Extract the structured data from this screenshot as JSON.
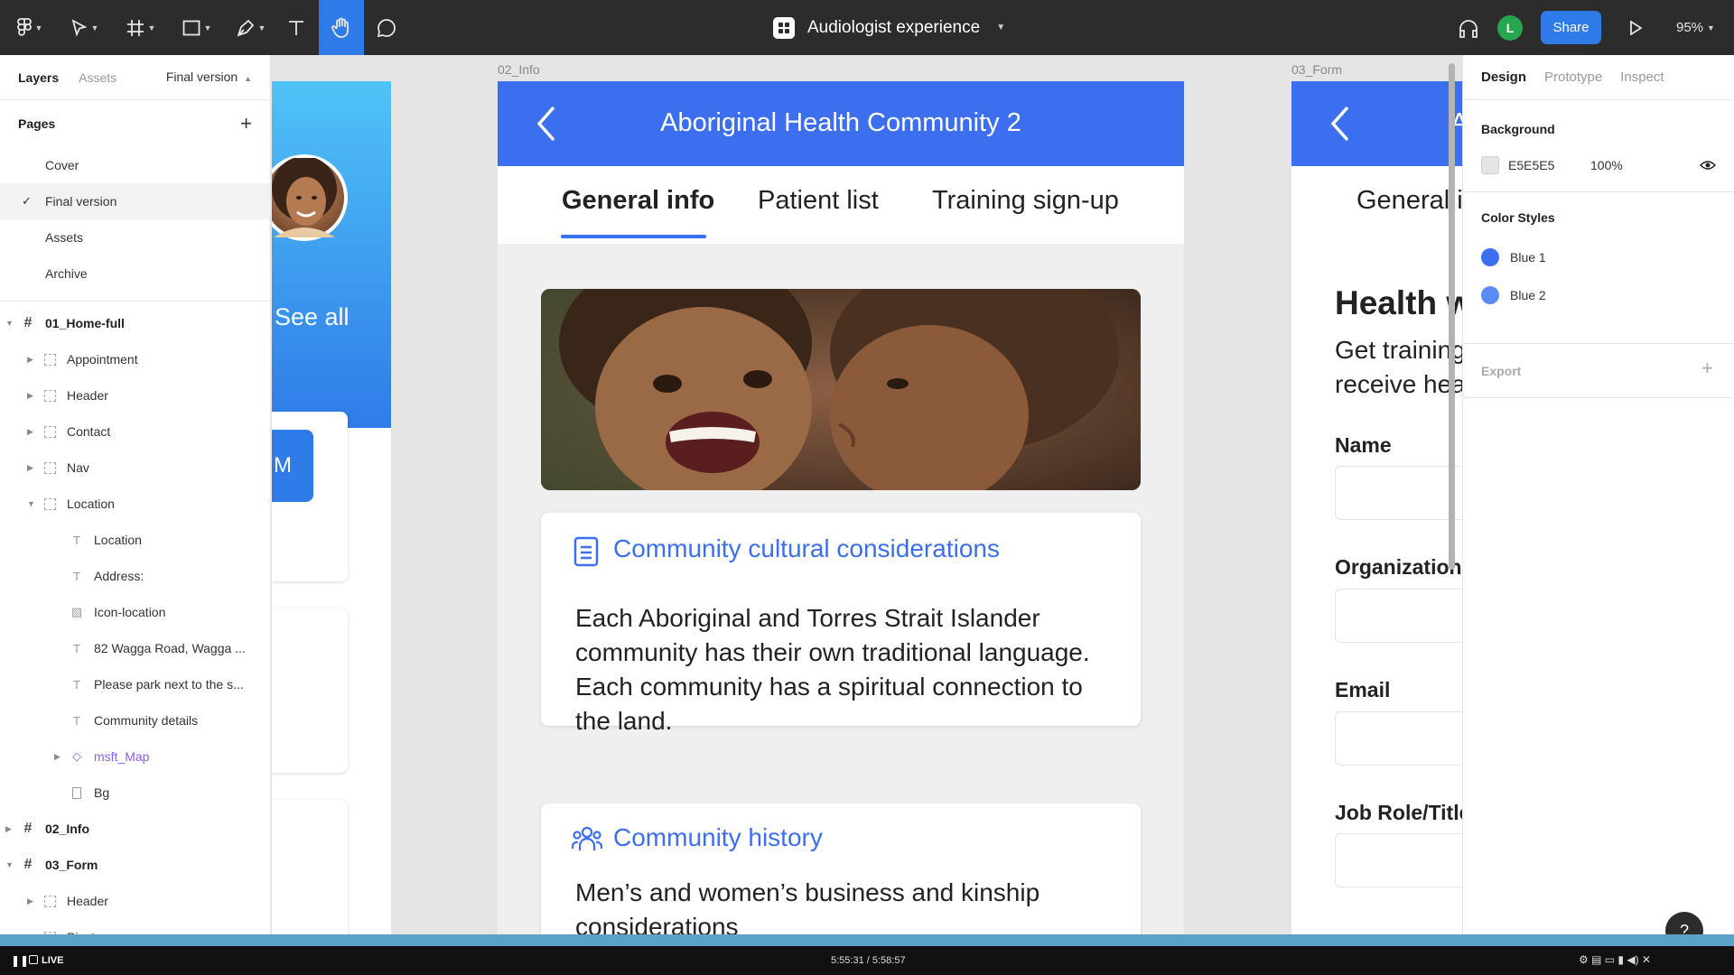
{
  "toolbar": {
    "doc_title": "Audiologist experience",
    "avatar_initial": "L",
    "share_label": "Share",
    "zoom": "95%",
    "accent": "#2f7be8"
  },
  "left_panel": {
    "tabs": [
      "Layers",
      "Assets"
    ],
    "current_page": "Final version",
    "pages_label": "Pages",
    "pages": [
      "Cover",
      "Final version",
      "Assets",
      "Archive"
    ],
    "layers": [
      {
        "label": "01_Home-full",
        "type": "frame",
        "depth": 0,
        "expanded": true
      },
      {
        "label": "Appointment",
        "type": "group",
        "depth": 1
      },
      {
        "label": "Header",
        "type": "group",
        "depth": 1
      },
      {
        "label": "Contact",
        "type": "group",
        "depth": 1
      },
      {
        "label": "Nav",
        "type": "group",
        "depth": 1
      },
      {
        "label": "Location",
        "type": "group",
        "depth": 1,
        "expanded": true
      },
      {
        "label": "Location",
        "type": "text",
        "depth": 2
      },
      {
        "label": "Address:",
        "type": "text",
        "depth": 2
      },
      {
        "label": "Icon-location",
        "type": "image",
        "depth": 2
      },
      {
        "label": "82 Wagga Road, Wagga ...",
        "type": "text",
        "depth": 2
      },
      {
        "label": "Please park next to the s...",
        "type": "text",
        "depth": 2
      },
      {
        "label": "Community details",
        "type": "text",
        "depth": 2
      },
      {
        "label": "msft_Map",
        "type": "component",
        "depth": 2
      },
      {
        "label": "Bg",
        "type": "rect",
        "depth": 2
      },
      {
        "label": "02_Info",
        "type": "frame",
        "depth": 0
      },
      {
        "label": "03_Form",
        "type": "frame",
        "depth": 0,
        "expanded": true
      },
      {
        "label": "Header",
        "type": "group",
        "depth": 1
      },
      {
        "label": "Pivots",
        "type": "group",
        "depth": 1
      }
    ]
  },
  "canvas": {
    "home": {
      "see_all": "See all",
      "button_fragment": "M"
    },
    "info": {
      "frame_label": "02_Info",
      "title": "Aboriginal Health Community 2",
      "tabs": [
        "General info",
        "Patient list",
        "Training sign-up"
      ],
      "cards": [
        {
          "icon": "document-icon",
          "title": "Community cultural considerations",
          "body": "Each Aboriginal and Torres Strait Islander community has their own traditional language. Each community has a spiritual connection to the land."
        },
        {
          "icon": "people-icon",
          "title": "Community history",
          "body": "Men’s and women’s business and kinship considerations"
        }
      ],
      "header_color": "#3b6ff0"
    },
    "form": {
      "frame_label": "03_Form",
      "header_fragment": "A",
      "tab_fragment": "General i",
      "heading": "Health w",
      "subtext_line1": "Get training",
      "subtext_line2": "receive hea",
      "labels": [
        "Name",
        "Organization",
        "Email",
        "Job Role/Title"
      ]
    }
  },
  "right_panel": {
    "tabs": [
      "Design",
      "Prototype",
      "Inspect"
    ],
    "background_label": "Background",
    "background_hex": "E5E5E5",
    "background_opacity": "100%",
    "color_styles_label": "Color Styles",
    "color_styles": [
      {
        "name": "Blue 1",
        "color": "#3b6ff0"
      },
      {
        "name": "Blue 2",
        "color": "#5a8cf5"
      }
    ],
    "export_label": "Export"
  },
  "video": {
    "live_label": "LIVE",
    "timecode": "5:55:31 / 5:58:57"
  },
  "help": "?"
}
